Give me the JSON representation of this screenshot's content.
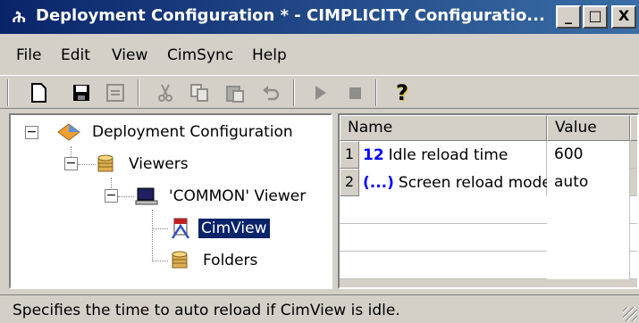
{
  "window": {
    "title": "Deployment Configuration * - CIMPLICITY Configuratio...",
    "min_label": "_",
    "max_label": "□",
    "close_label": "X"
  },
  "menu": [
    "File",
    "Edit",
    "View",
    "CimSync",
    "Help"
  ],
  "toolbar": [
    {
      "icon": "new-document-icon",
      "enabled": true
    },
    {
      "icon": "save-icon",
      "enabled": true
    },
    {
      "icon": "properties-icon",
      "enabled": false
    },
    {
      "icon": "cut-icon",
      "enabled": false
    },
    {
      "icon": "copy-icon",
      "enabled": false
    },
    {
      "icon": "paste-icon",
      "enabled": false
    },
    {
      "icon": "undo-icon",
      "enabled": false
    },
    {
      "icon": "run-icon",
      "enabled": false
    },
    {
      "icon": "stop-icon",
      "enabled": false
    },
    {
      "icon": "help-icon",
      "enabled": true,
      "glyph": "?"
    }
  ],
  "tree": {
    "root": {
      "label": "Deployment Configuration",
      "icon": "deployment-icon",
      "expanded": true
    },
    "viewers": {
      "label": "Viewers",
      "icon": "cylinder-icon",
      "expanded": true
    },
    "common_viewer": {
      "label": "'COMMON' Viewer",
      "icon": "computer-icon",
      "expanded": true
    },
    "cimview": {
      "label": "CimView",
      "icon": "cimview-icon",
      "selected": true
    },
    "folders": {
      "label": "Folders",
      "icon": "folders-icon"
    }
  },
  "grid": {
    "columns": [
      "Name",
      "Value"
    ],
    "rows": [
      {
        "num": "1",
        "type": "12",
        "name": "Idle reload time",
        "value": "600"
      },
      {
        "num": "2",
        "type": "(...)",
        "name": "Screen reload mode",
        "value": "auto"
      }
    ]
  },
  "status": "Specifies the time to auto reload if CimView is idle.",
  "colors": {
    "titlebar": "#0a246a",
    "selection": "#0a246a",
    "type_badge": "#0000ff"
  }
}
